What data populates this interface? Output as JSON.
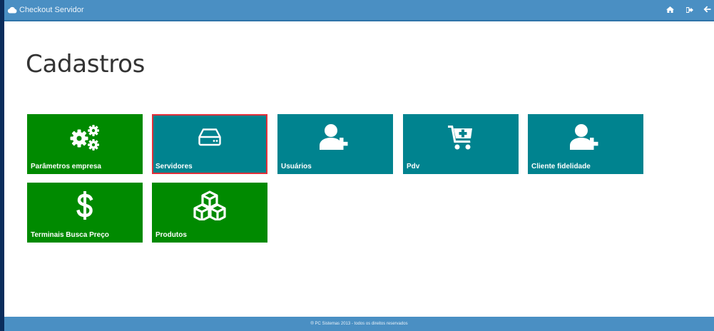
{
  "app": {
    "title": "Checkout Servidor",
    "cloud_icon": "cloud-icon"
  },
  "header_actions": [
    {
      "icon": "home-icon"
    },
    {
      "icon": "logout-icon"
    },
    {
      "icon": "arrow-left-icon"
    }
  ],
  "page": {
    "title": "Cadastros"
  },
  "tiles": [
    {
      "label": "Parâmetros empresa",
      "icon": "gears-icon",
      "color": "#008a00"
    },
    {
      "label": "Servidores",
      "icon": "hard-drive-icon",
      "color": "#00838f",
      "selected": true
    },
    {
      "label": "Usuários",
      "icon": "user-plus-icon",
      "color": "#00838f"
    },
    {
      "label": "Pdv",
      "icon": "cart-plus-icon",
      "color": "#00838f"
    },
    {
      "label": "Cliente fidelidade",
      "icon": "user-plus-icon",
      "color": "#00838f"
    },
    {
      "label": "Terminais Busca Preço",
      "icon": "dollar-icon",
      "color": "#008a00"
    },
    {
      "label": "Produtos",
      "icon": "cubes-icon",
      "color": "#008a00"
    }
  ],
  "footer": {
    "text": "® PC Sistemas 2013 - todos os direitos reservados"
  },
  "colors": {
    "header": "#4a8fc3",
    "tile_green": "#008a00",
    "tile_teal": "#00838f",
    "selection": "#e0303a"
  }
}
